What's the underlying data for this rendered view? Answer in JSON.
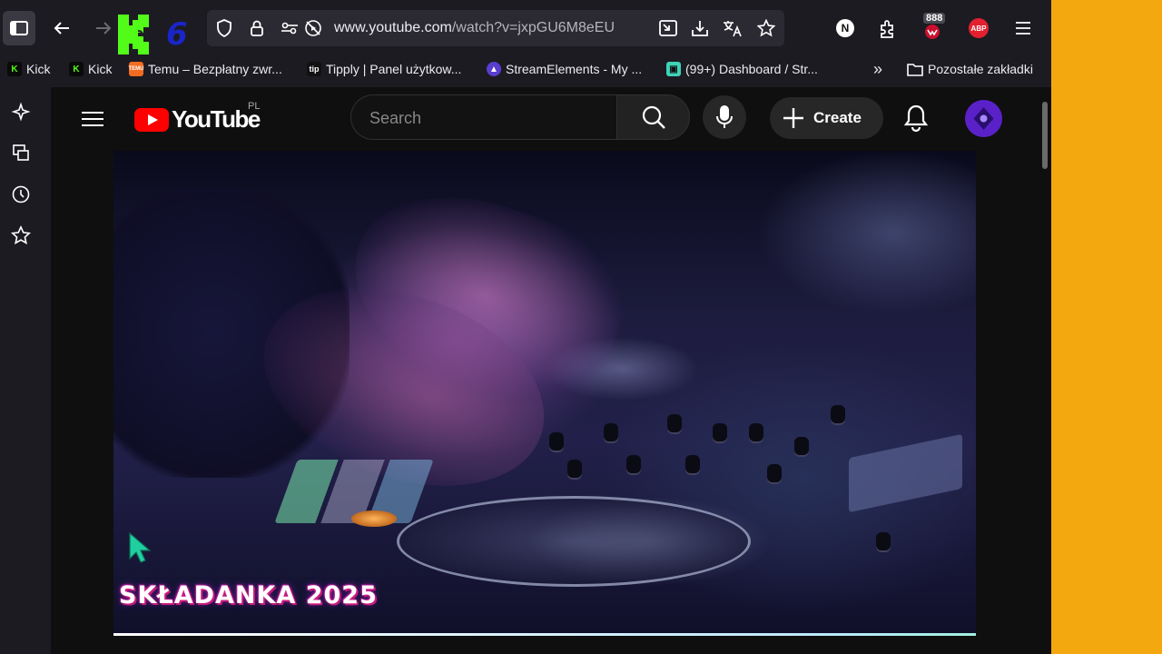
{
  "browser": {
    "url_base": "www.youtube.com",
    "url_path": "/watch?v=jxpGU6M8eEU",
    "kick_number": "6",
    "badge_count": "888",
    "profile_letter": "N",
    "abp_label": "ABP"
  },
  "bookmarks": [
    {
      "label": "Kick",
      "icon": "kick-icon",
      "color": "#53fc18"
    },
    {
      "label": "Kick",
      "icon": "kick-icon",
      "color": "#53fc18"
    },
    {
      "label": "Temu – Bezpłatny zwr...",
      "icon": "temu-icon",
      "color": "#f46c22"
    },
    {
      "label": "Tipply | Panel użytkow...",
      "icon": "tipply-icon",
      "color": "#111111"
    },
    {
      "label": "StreamElements - My ...",
      "icon": "streamelements-icon",
      "color": "#5a3ecf"
    },
    {
      "label": "(99+) Dashboard / Str...",
      "icon": "twitch-dashboard-icon",
      "color": "#3fd3b7"
    }
  ],
  "bookmarks_other": "Pozostałe zakładki",
  "youtube": {
    "logo_text": "YouTube",
    "country_code": "PL",
    "search_placeholder": "Search",
    "create_label": "Create"
  },
  "video": {
    "overlay_title": "SKŁADANKA 2025"
  },
  "colors": {
    "accent_panel": "#f4a80f",
    "youtube_red": "#ff0000",
    "avatar": "#5a21c9"
  }
}
